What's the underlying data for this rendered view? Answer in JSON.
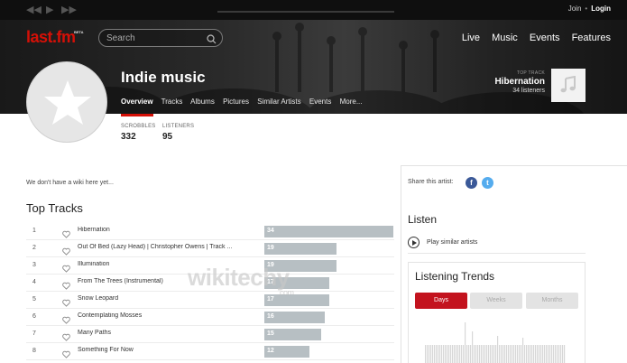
{
  "player": {
    "prev_icon": "rewind-icon",
    "play_icon": "play-icon",
    "next_icon": "fast-forward-icon"
  },
  "auth": {
    "join": "Join",
    "login": "Login"
  },
  "header": {
    "logo": "last.fm",
    "beta": "BETA",
    "search_placeholder": "Search",
    "nav": [
      "Live",
      "Music",
      "Events",
      "Features"
    ]
  },
  "tag": {
    "title": "Indie music",
    "tabs": [
      "Overview",
      "Tracks",
      "Albums",
      "Pictures",
      "Similar Artists",
      "Events",
      "More..."
    ],
    "active_tab": "Overview"
  },
  "top_track": {
    "label": "TOP TRACK",
    "name": "Hibernation",
    "listeners": "34 listeners"
  },
  "stats": [
    {
      "label": "SCROBBLES",
      "value": "332"
    },
    {
      "label": "LISTENERS",
      "value": "95"
    }
  ],
  "wiki_text": "We don't have a wiki here yet...",
  "top_tracks": {
    "title": "Top Tracks",
    "items": [
      {
        "num": "1",
        "name": "Hibernation",
        "count": 34
      },
      {
        "num": "2",
        "name": "Out Of Bed (Lazy Head) | Christopher Owens | Track ...",
        "count": 19
      },
      {
        "num": "3",
        "name": "Illumination",
        "count": 19
      },
      {
        "num": "4",
        "name": "From The Trees (Instrumental)",
        "count": 17
      },
      {
        "num": "5",
        "name": "Snow Leopard",
        "count": 17
      },
      {
        "num": "6",
        "name": "Contemplating Mosses",
        "count": 16
      },
      {
        "num": "7",
        "name": "Many Paths",
        "count": 15
      },
      {
        "num": "8",
        "name": "Something For Now",
        "count": 12
      }
    ]
  },
  "watermark": {
    "text": "wikitechy",
    "domain": ".com"
  },
  "share": {
    "label": "Share this artist:",
    "facebook": "f",
    "twitter": "t"
  },
  "listen": {
    "title": "Listen",
    "play_similar": "Play similar artists"
  },
  "trends": {
    "title": "Listening Trends",
    "tabs": [
      "Days",
      "Weeks",
      "Months"
    ],
    "active": "Days"
  },
  "colors": {
    "accent": "#d51007",
    "bar": "#b7bfc3",
    "facebook": "#3b5998",
    "twitter": "#55acee"
  }
}
